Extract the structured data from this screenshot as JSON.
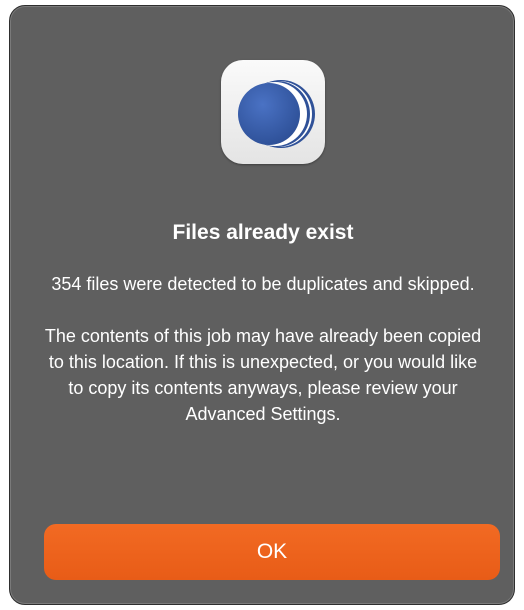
{
  "dialog": {
    "icon": "app-logo-icon",
    "title": "Files already exist",
    "message_paragraphs": [
      "354 files were detected to be duplicates and skipped.",
      "The contents of this job may have already been copied to this location. If this is unexpected, or you would like to copy its contents anyways, please review your Advanced Settings."
    ],
    "ok_label": "OK"
  },
  "colors": {
    "dialog_background": "#5f5f5f",
    "button_accent": "#f26a23",
    "icon_blue": "#3a5da6"
  }
}
